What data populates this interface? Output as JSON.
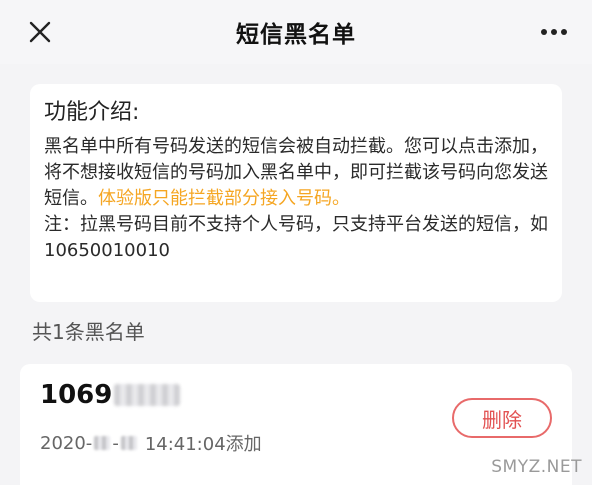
{
  "header": {
    "title": "短信黑名单",
    "close_icon": "close-icon",
    "more_icon": "more-icon"
  },
  "intro": {
    "title": "功能介绍:",
    "body": "黑名单中所有号码发送的短信会被自动拦截。您可以点击添加，将不想接收短信的号码加入黑名单中，即可拦截该号码向您发送短信。",
    "highlight": "体验版只能拦截部分接入号码。",
    "note": "注：拉黑号码目前不支持个人号码，只支持平台发送的短信，如10650010010",
    "highlight_color": "#f5a623"
  },
  "list": {
    "count_label": "共1条黑名单",
    "items": [
      {
        "number_prefix": "1069",
        "date_prefix": "2020-",
        "date_sep": "-",
        "date_suffix": "14:41:04添加",
        "delete_label": "删除"
      }
    ]
  },
  "watermark": "SMYZ.NET",
  "colors": {
    "accent_orange": "#f5a623",
    "delete_red": "#e25252",
    "background": "#f4f4f6"
  }
}
